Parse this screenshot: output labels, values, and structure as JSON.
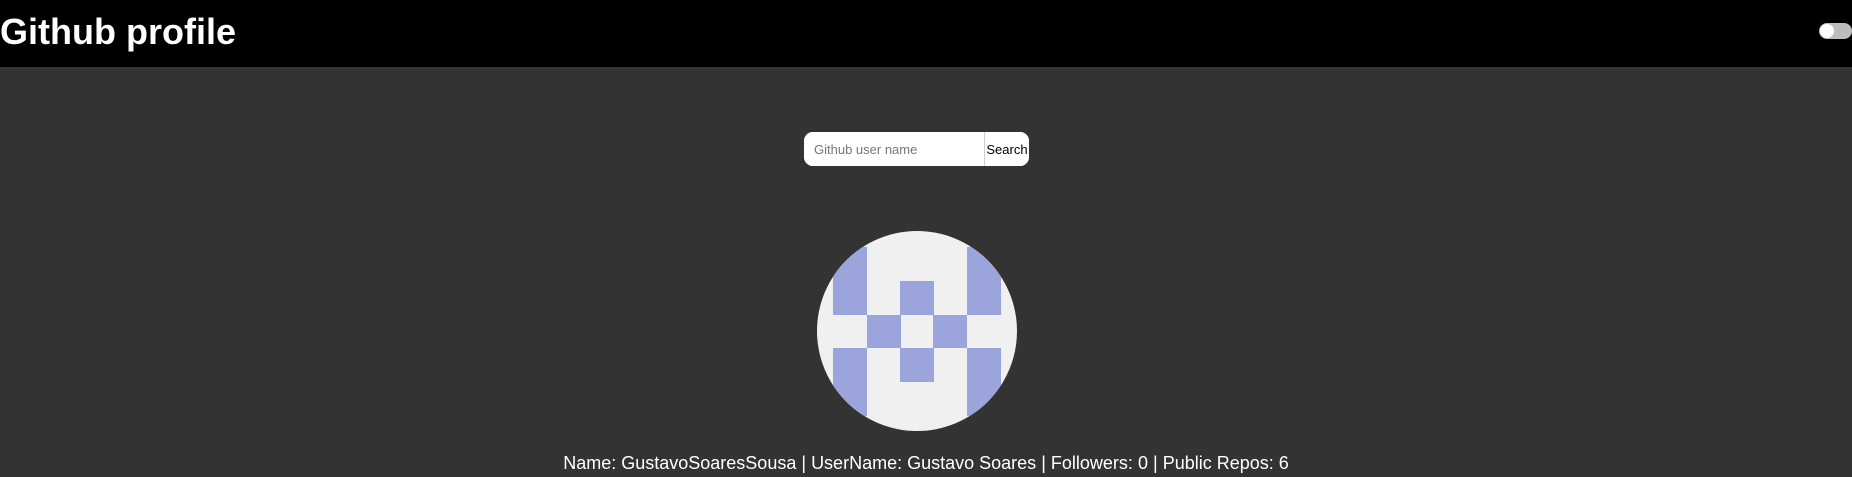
{
  "header": {
    "title": "Github profile",
    "theme_toggle_state": "off"
  },
  "search": {
    "placeholder": "Github user name",
    "value": "",
    "button_label": "Search"
  },
  "profile": {
    "avatar_icon": "identicon-avatar",
    "avatar_colors": {
      "background": "#f0f0f0",
      "pattern": "#9ba5db"
    },
    "name_label": "Name:",
    "name": "GustavoSoaresSousa",
    "username_label": "UserName:",
    "username": "Gustavo Soares",
    "followers_label": "Followers:",
    "followers": "0",
    "repos_label": "Public Repos:",
    "repos": "6",
    "separator": "|"
  },
  "colors": {
    "page_background": "#333333",
    "header_background": "#000000",
    "text": "#ffffff"
  }
}
